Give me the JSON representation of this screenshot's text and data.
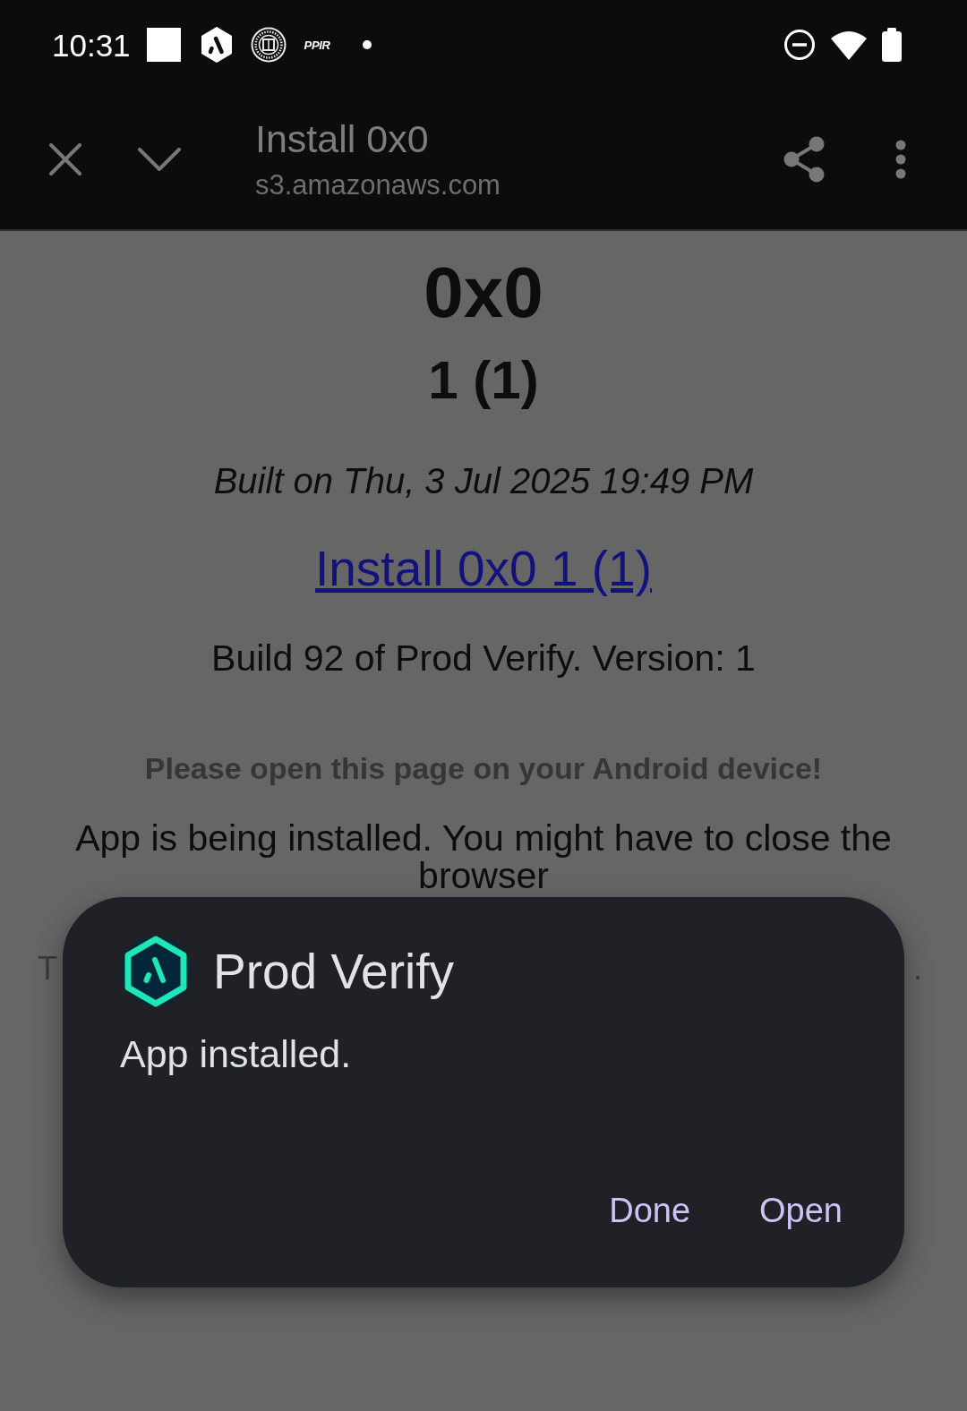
{
  "status_bar": {
    "time": "10:31",
    "notification_label": "PPIR"
  },
  "toolbar": {
    "title": "Install 0x0",
    "url": "s3.amazonaws.com"
  },
  "page": {
    "app_name": "0x0",
    "version": "1 (1)",
    "built_on": "Built on Thu, 3 Jul 2025 19:49 PM",
    "install_link": "Install 0x0 1 (1)",
    "build_info": "Build 92 of Prod Verify. Version: 1",
    "notice": "Please open this page on your Android device!",
    "install_message": "App is being installed. You might have to close the browser",
    "covered_line": {
      "start": "T",
      "end": "."
    }
  },
  "dialog": {
    "title": "Prod Verify",
    "message": "App installed.",
    "buttons": [
      {
        "label": "Done"
      },
      {
        "label": "Open"
      }
    ]
  }
}
